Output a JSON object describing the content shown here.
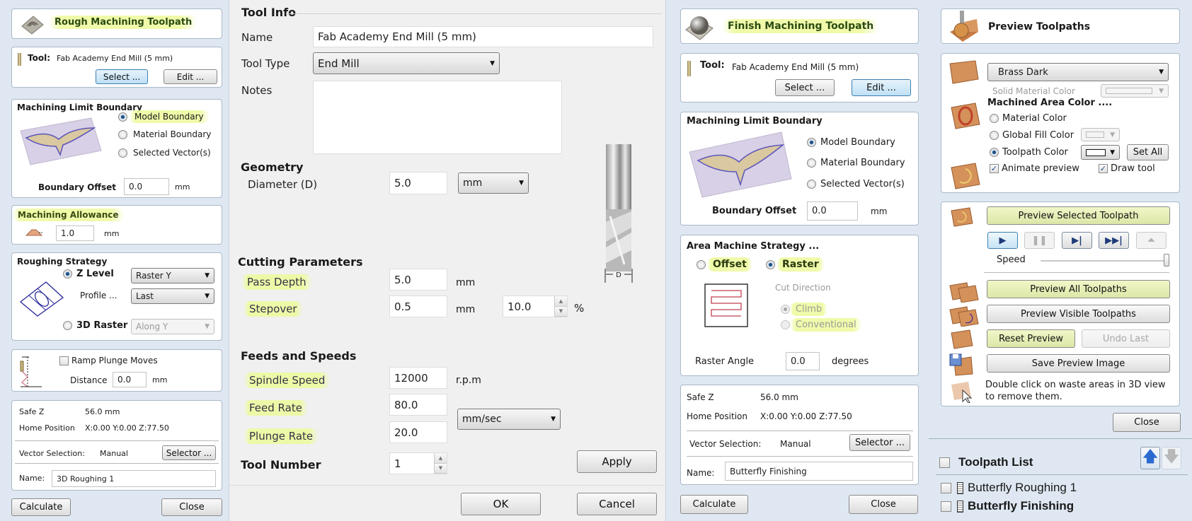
{
  "rough": {
    "title": "Rough Machining Toolpath",
    "tool_label": "Tool:",
    "tool_name": "Fab Academy End Mill (5 mm)",
    "select_btn": "Select ...",
    "edit_btn": "Edit ...",
    "boundary": {
      "title": "Machining Limit Boundary",
      "options": [
        "Model Boundary",
        "Material Boundary",
        "Selected Vector(s)"
      ],
      "selected": "Model Boundary",
      "offset_label": "Boundary Offset",
      "offset_value": "0.0",
      "offset_unit": "mm"
    },
    "allowance": {
      "title": "Machining Allowance",
      "value": "1.0",
      "unit": "mm"
    },
    "strategy": {
      "title": "Roughing Strategy",
      "zlevel_label": "Z Level",
      "zlevel_select": "Raster Y",
      "profile_label": "Profile ...",
      "profile_select": "Last",
      "raster3d_label": "3D Raster",
      "raster3d_select": "Along Y",
      "selected": "Z Level"
    },
    "ramp": {
      "label": "Ramp Plunge Moves",
      "checked": false,
      "distance_label": "Distance",
      "distance_value": "0.0",
      "distance_unit": "mm"
    },
    "info": {
      "safez_label": "Safe Z",
      "safez_value": "56.0 mm",
      "home_label": "Home Position",
      "home_value": "X:0.00 Y:0.00 Z:77.50",
      "vector_label": "Vector Selection:",
      "vector_value": "Manual",
      "selector_btn": "Selector ...",
      "name_label": "Name:",
      "name_value": "3D Roughing 1"
    },
    "calculate_btn": "Calculate",
    "close_btn": "Close"
  },
  "tool": {
    "section_info": "Tool Info",
    "name_label": "Name",
    "name_value": "Fab Academy End Mill (5 mm)",
    "type_label": "Tool Type",
    "type_value": "End Mill",
    "notes_label": "Notes",
    "notes_value": "",
    "section_geometry": "Geometry",
    "diameter_label": "Diameter (D)",
    "diameter_value": "5.0",
    "diameter_unit": "mm",
    "diagram_label": "D",
    "section_cutting": "Cutting Parameters",
    "pass_depth_label": "Pass Depth",
    "pass_depth_value": "5.0",
    "pass_depth_unit": "mm",
    "stepover_label": "Stepover",
    "stepover_value": "0.5",
    "stepover_unit": "mm",
    "stepover_pct_value": "10.0",
    "stepover_pct_unit": "%",
    "section_feeds": "Feeds and Speeds",
    "spindle_label": "Spindle Speed",
    "spindle_value": "12000",
    "spindle_unit": "r.p.m",
    "feed_label": "Feed Rate",
    "feed_value": "80.0",
    "plunge_label": "Plunge Rate",
    "plunge_value": "20.0",
    "rate_unit": "mm/sec",
    "toolnum_label": "Tool Number",
    "toolnum_value": "1",
    "apply_btn": "Apply",
    "ok_btn": "OK",
    "cancel_btn": "Cancel"
  },
  "finish": {
    "title": "Finish Machining Toolpath",
    "tool_label": "Tool:",
    "tool_name": "Fab Academy End Mill (5 mm)",
    "select_btn": "Select ...",
    "edit_btn": "Edit ...",
    "boundary": {
      "title": "Machining Limit Boundary",
      "options": [
        "Model Boundary",
        "Material Boundary",
        "Selected Vector(s)"
      ],
      "selected": "Model Boundary",
      "offset_label": "Boundary Offset",
      "offset_value": "0.0",
      "offset_unit": "mm"
    },
    "strategy": {
      "title": "Area Machine Strategy ...",
      "offset_label": "Offset",
      "raster_label": "Raster",
      "selected": "Raster",
      "cut_direction_label": "Cut Direction",
      "climb_label": "Climb",
      "conventional_label": "Conventional",
      "cut_selected": "Climb",
      "raster_angle_label": "Raster Angle",
      "raster_angle_value": "0.0",
      "raster_angle_unit": "degrees"
    },
    "info": {
      "safez_label": "Safe Z",
      "safez_value": "56.0 mm",
      "home_label": "Home Position",
      "home_value": "X:0.00 Y:0.00 Z:77.50",
      "vector_label": "Vector Selection:",
      "vector_value": "Manual",
      "selector_btn": "Selector ...",
      "name_label": "Name:",
      "name_value": "Butterfly Finishing"
    },
    "calculate_btn": "Calculate",
    "close_btn": "Close"
  },
  "preview": {
    "title": "Preview Toolpaths",
    "material_select": "Brass Dark",
    "solid_color_label": "Solid Material Color",
    "machined_title": "Machined Area Color ....",
    "material_color_label": "Material Color",
    "global_fill_label": "Global Fill Color",
    "toolpath_color_label": "Toolpath Color",
    "color_selected": "Toolpath Color",
    "set_all_btn": "Set All",
    "animate_label": "Animate preview",
    "animate_checked": true,
    "draw_tool_label": "Draw tool",
    "draw_tool_checked": true,
    "preview_selected_btn": "Preview Selected Toolpath",
    "speed_label": "Speed",
    "speed_value": 1.0,
    "preview_all_btn": "Preview All Toolpaths",
    "preview_visible_btn": "Preview Visible Toolpaths",
    "reset_btn": "Reset Preview",
    "undo_btn": "Undo Last",
    "save_image_btn": "Save Preview Image",
    "hint": "Double click on waste areas in 3D view to remove them.",
    "close_btn": "Close"
  },
  "toolpath_list": {
    "title": "Toolpath List",
    "items": [
      {
        "name": "Butterfly Roughing 1",
        "checked": false,
        "bold": false
      },
      {
        "name": "Butterfly Finishing",
        "checked": false,
        "bold": true
      }
    ]
  }
}
